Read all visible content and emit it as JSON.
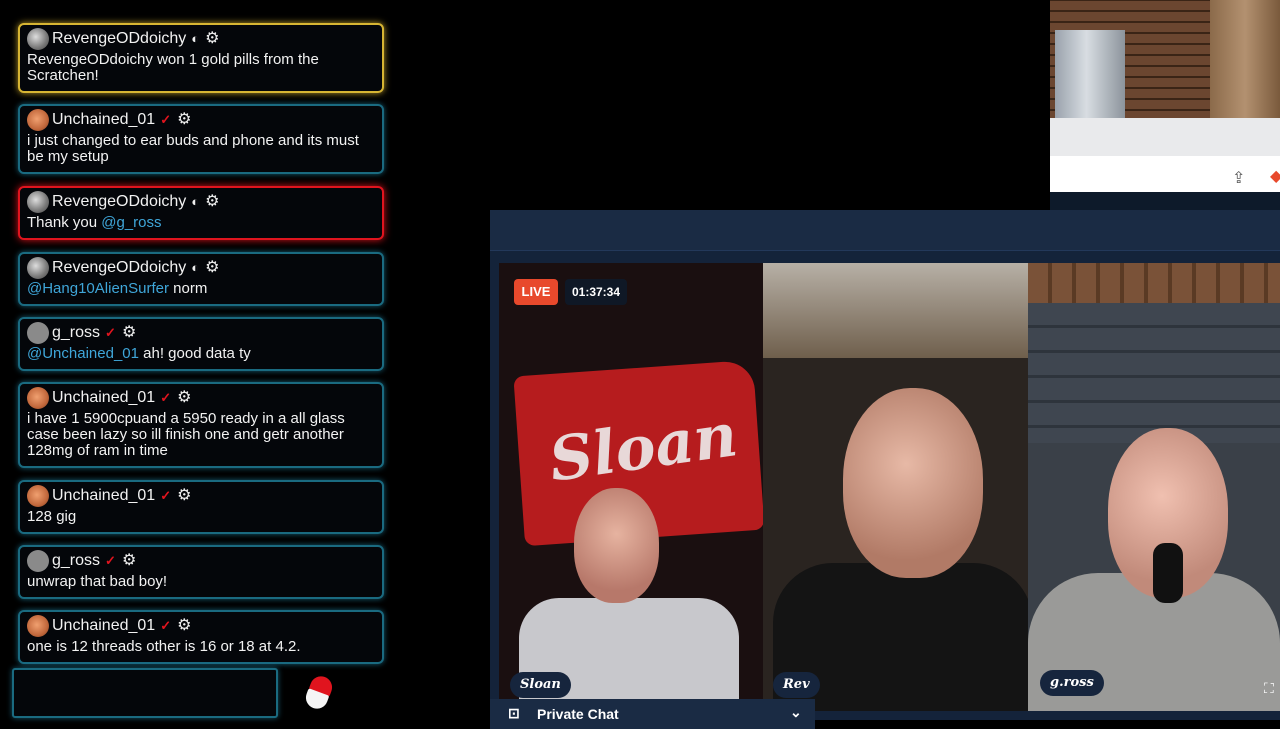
{
  "chat": {
    "messages": [
      {
        "user": "RevengeODdoichy",
        "shield": "◐",
        "check": "",
        "gear": "⚙",
        "mention": "",
        "text": "RevengeODdoichy won 1 gold pills from the Scratchen!"
      },
      {
        "user": "Unchained_01",
        "shield": "",
        "check": "✓",
        "gear": "⚙",
        "mention": "",
        "text": "i just changed to ear buds and phone and its must be my setup"
      },
      {
        "user": "RevengeODdoichy",
        "shield": "◐",
        "check": "",
        "gear": "⚙",
        "mention": "@g_ross",
        "text": "Thank you "
      },
      {
        "user": "RevengeODdoichy",
        "shield": "◐",
        "check": "",
        "gear": "⚙",
        "mention": "@Hang10AlienSurfer",
        "text": " norm"
      },
      {
        "user": "g_ross",
        "shield": "",
        "check": "✓",
        "gear": "⚙",
        "mention": "@Unchained_01",
        "text": " ah! good data ty"
      },
      {
        "user": "Unchained_01",
        "shield": "",
        "check": "✓",
        "gear": "⚙",
        "mention": "",
        "text": "i have 1 5900cpuand a 5950 ready in a all glass case been lazy so ill finish one and getr another 128mg of ram in time"
      },
      {
        "user": "Unchained_01",
        "shield": "",
        "check": "✓",
        "gear": "⚙",
        "mention": "",
        "text": "128 gig"
      },
      {
        "user": "g_ross",
        "shield": "",
        "check": "✓",
        "gear": "⚙",
        "mention": "",
        "text": "unwrap that bad boy!"
      },
      {
        "user": "Unchained_01",
        "shield": "",
        "check": "✓",
        "gear": "⚙",
        "mention": "",
        "text": "one is 12 threads other is 16 or 18 at 4.2."
      }
    ],
    "input_value": ""
  },
  "browser": {
    "share_icon": "⇪",
    "brave_icon": "◆"
  },
  "stream": {
    "live_label": "LIVE",
    "timer": "01:37:34",
    "banner_text": "Sloan",
    "participants": [
      "Sloan",
      "Rev",
      "g.ross"
    ],
    "private_chat_label": "Private Chat",
    "private_chat_icon": "⊡",
    "chevron": "⌄",
    "expand_icon": "⛶"
  },
  "colors": {
    "gold": "#d7b533",
    "red": "#e0141e",
    "cyan": "#1a6a80",
    "mention": "#3fa6d9",
    "live": "#e8492c"
  }
}
